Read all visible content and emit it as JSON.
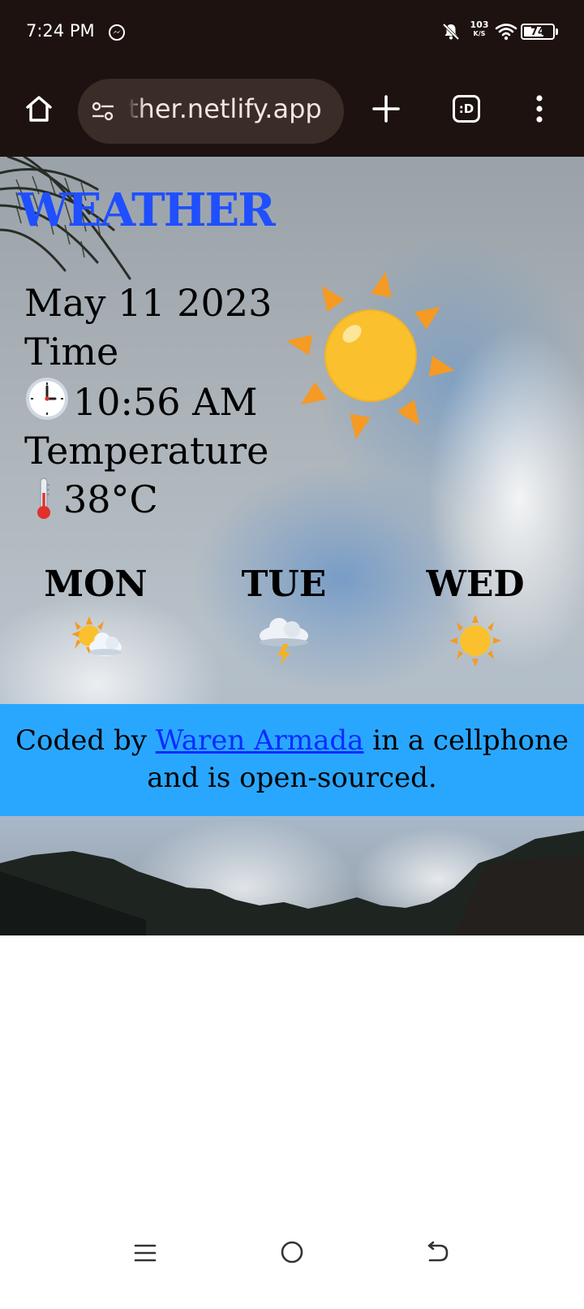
{
  "status_bar": {
    "time": "7:24 PM",
    "net_speed_value": "103",
    "net_speed_unit": "K/S",
    "battery": "74",
    "battery_level": 0.74,
    "icons": [
      "messenger-icon",
      "bell-off-icon",
      "wifi-icon",
      "battery-icon"
    ]
  },
  "browser": {
    "url": "ther.netlify.app",
    "tabs_label": ":D",
    "icons": [
      "home-icon",
      "site-settings-icon",
      "plus-icon",
      "tabs-icon",
      "more-vert-icon"
    ]
  },
  "page": {
    "title": "WEATHER",
    "date": "May 11 2023",
    "time_label": "Time",
    "time_value": "10:56 AM",
    "temperature_label": "Temperature",
    "temperature_value": "38°C",
    "current_icon": "sun-icon",
    "forecast": [
      {
        "day": "MON",
        "icon": "sun-behind-cloud-icon"
      },
      {
        "day": "TUE",
        "icon": "cloud-lightning-icon"
      },
      {
        "day": "WED",
        "icon": "sun-icon"
      }
    ],
    "footer": {
      "prefix": "Coded by ",
      "link": "Waren Armada",
      "suffix": " in a cellphone and is open-sourced."
    }
  },
  "colors": {
    "title": "#1f4fff",
    "footer_bg": "#29a7ff",
    "link": "#0b2bff",
    "chrome_bg": "#1d1210"
  }
}
